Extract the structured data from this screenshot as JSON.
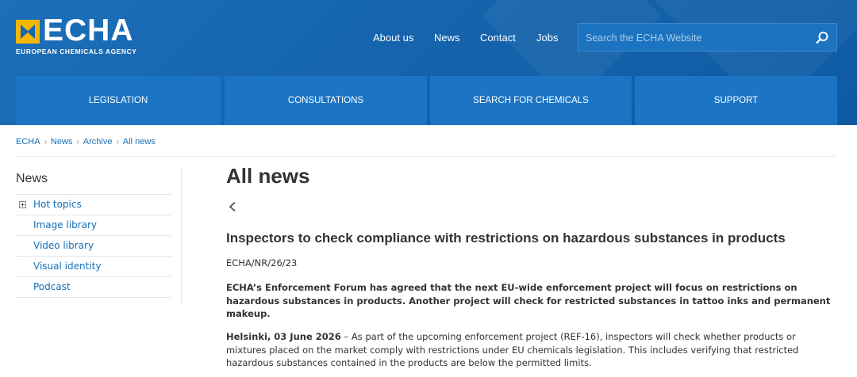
{
  "header": {
    "logo_text": "ECHA",
    "logo_sub": "EUROPEAN CHEMICALS AGENCY",
    "top_links": [
      "About us",
      "News",
      "Contact",
      "Jobs"
    ],
    "search_placeholder": "Search the ECHA Website"
  },
  "main_nav": [
    "LEGISLATION",
    "CONSULTATIONS",
    "SEARCH FOR CHEMICALS",
    "SUPPORT"
  ],
  "breadcrumb": [
    "ECHA",
    "News",
    "Archive",
    "All news"
  ],
  "sidebar": {
    "title": "News",
    "items": [
      "Hot topics",
      "Image library",
      "Video library",
      "Visual identity",
      "Podcast"
    ]
  },
  "content": {
    "page_title": "All news",
    "article_title": "Inspectors to check compliance with restrictions on hazardous substances in products",
    "reference": "ECHA/NR/26/23",
    "lead": "ECHA’s Enforcement Forum has agreed that the next EU-wide enforcement project will focus on restrictions on hazardous substances in products. Another project will check for restricted substances in tattoo inks and permanent makeup.",
    "dateline": "Helsinki, 03 June 2026",
    "body": " – As part of the upcoming enforcement project (REF-16), inspectors will check whether products or mixtures placed on the market comply with restrictions under EU chemicals legislation. This includes verifying that restricted hazardous substances contained in the products are below the permitted limits."
  },
  "colors": {
    "header_bg": "#1566ae",
    "tab_bg": "#1b75c4",
    "logo_yellow": "#f2b705",
    "link": "#1670b7"
  }
}
